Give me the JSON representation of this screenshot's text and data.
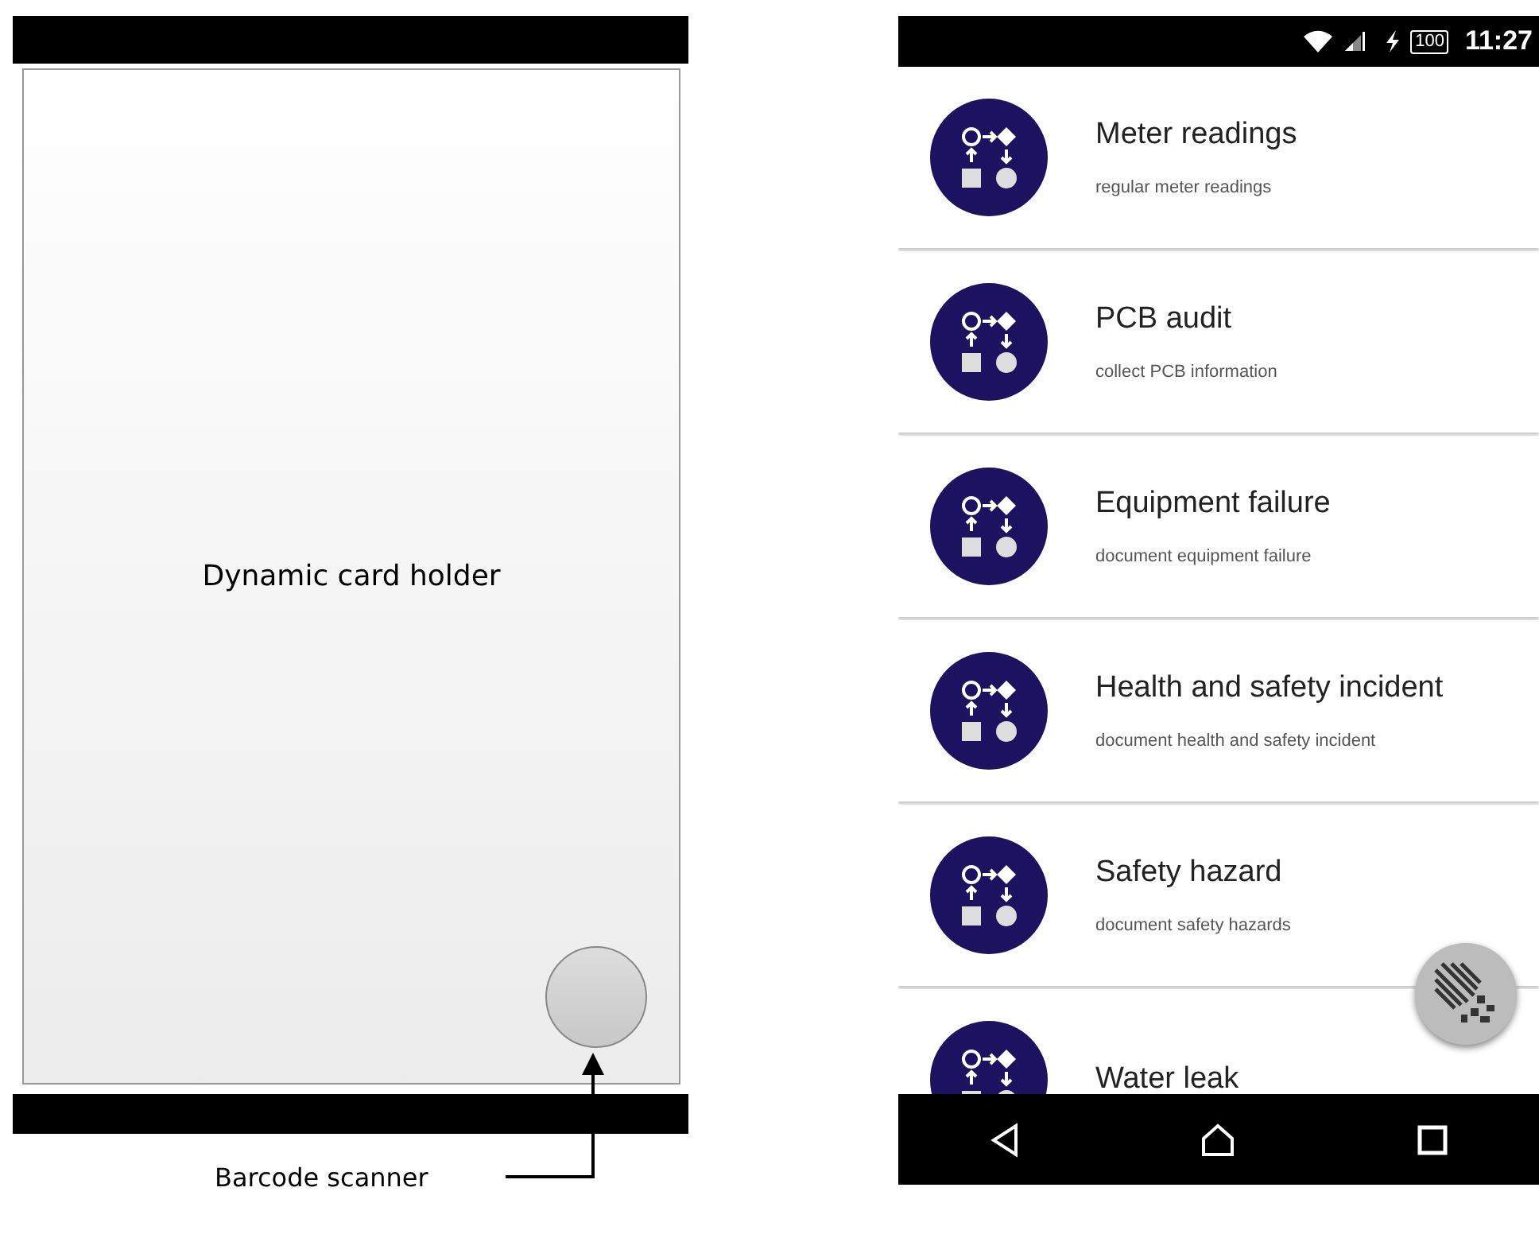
{
  "mockup": {
    "card_holder_label": "Dynamic card holder",
    "callout": "Barcode scanner"
  },
  "phone": {
    "status_bar": {
      "battery": "100",
      "time": "11:27"
    },
    "items": [
      {
        "title": "Meter readings",
        "subtitle": "regular meter readings"
      },
      {
        "title": "PCB audit",
        "subtitle": "collect PCB information"
      },
      {
        "title": "Equipment failure",
        "subtitle": "document equipment failure"
      },
      {
        "title": "Health and safety incident",
        "subtitle": "document health and safety incident"
      },
      {
        "title": "Safety hazard",
        "subtitle": "document safety hazards"
      },
      {
        "title": "Water leak"
      }
    ]
  }
}
